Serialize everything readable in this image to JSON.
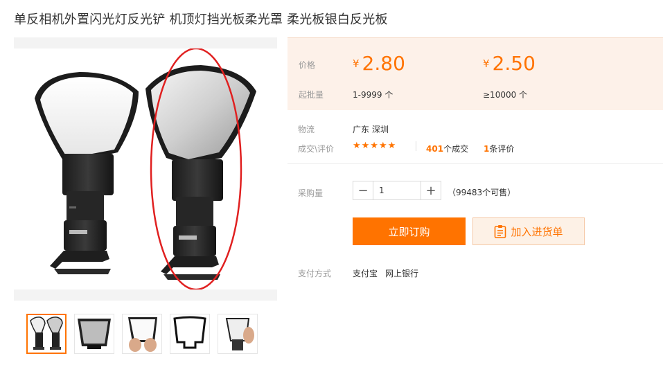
{
  "product": {
    "title": "单反相机外置闪光灯反光铲 机顶灯挡光板柔光罩 柔光板银白反光板"
  },
  "price": {
    "label": "价格",
    "currency": "¥",
    "tiers": [
      {
        "price": "2.80",
        "range": "1-9999 个"
      },
      {
        "price": "2.50",
        "range": "≥10000 个"
      }
    ],
    "min_order_label": "起批量"
  },
  "logistics": {
    "label": "物流",
    "value": "广东 深圳"
  },
  "deals": {
    "label": "成交\\评价",
    "stars": "★★★★★",
    "deal_count": "401",
    "deal_suffix": "个成交",
    "review_count": "1",
    "review_suffix": "条评价"
  },
  "purchase": {
    "label": "采购量",
    "quantity": "1",
    "minus": "−",
    "plus": "+",
    "available": "（99483个可售）"
  },
  "actions": {
    "buy_now": "立即订购",
    "add_to_cart": "加入进货单"
  },
  "payment": {
    "label": "支付方式",
    "methods": [
      "支付宝",
      "网上银行"
    ]
  },
  "colors": {
    "accent": "#ff7300",
    "price_bg": "#fdf1e9",
    "annotation": "#e02020"
  },
  "icons": {
    "cart": "clipboard-list-icon"
  }
}
